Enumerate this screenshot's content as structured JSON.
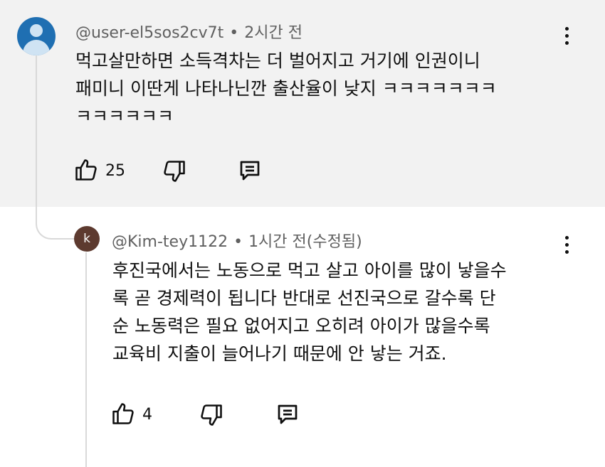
{
  "comments": [
    {
      "author": "@user-el5sos2cv7t",
      "separator": "•",
      "time": "2시간 전",
      "avatar_icon": "default-user-avatar-icon",
      "text_lines": [
        "먹고살만하면 소득격차는 더  벌어지고 거기에  인권이니",
        "패미니 이딴게 나타나닌깐 출산율이 낮지 ㅋㅋㅋㅋㅋㅋㅋ",
        "ㅋㅋㅋㅋㅋㅋ"
      ],
      "like_count": "25"
    },
    {
      "author": "@Kim-tey1122",
      "separator": "•",
      "time": "1시간 전(수정됨)",
      "avatar_letter": "k",
      "text_lines": [
        "후진국에서는 노동으로 먹고 살고 아이를 많이 낳을수",
        "록 곧 경제력이 됩니다 반대로 선진국으로 갈수록 단",
        "순 노동력은 필요 없어지고 오히려 아이가 많을수록",
        "교육비 지출이 늘어나기 때문에 안 낳는 거죠."
      ],
      "like_count": "4"
    }
  ],
  "colors": {
    "top_background": "#f2f2f2",
    "meta_text": "#606060",
    "avatar_user": "#1f6fb2",
    "avatar_k": "#5d3a2f"
  }
}
